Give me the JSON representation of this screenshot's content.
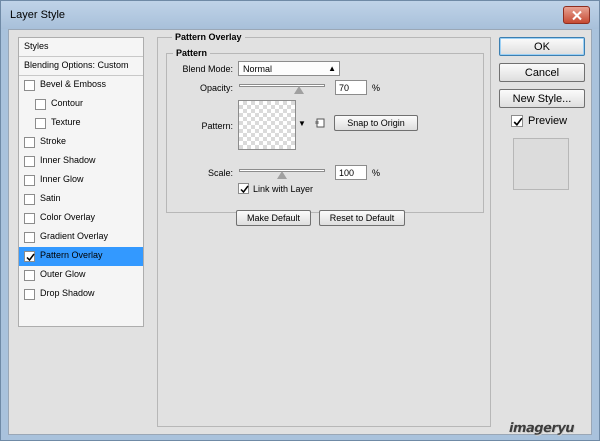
{
  "window": {
    "title": "Layer Style",
    "close_icon": "close-icon"
  },
  "styles": {
    "header": "Styles",
    "blending_options": "Blending Options: Custom",
    "items": [
      {
        "label": "Bevel & Emboss",
        "checked": false,
        "indent": false,
        "selected": false
      },
      {
        "label": "Contour",
        "checked": false,
        "indent": true,
        "selected": false
      },
      {
        "label": "Texture",
        "checked": false,
        "indent": true,
        "selected": false
      },
      {
        "label": "Stroke",
        "checked": false,
        "indent": false,
        "selected": false
      },
      {
        "label": "Inner Shadow",
        "checked": false,
        "indent": false,
        "selected": false
      },
      {
        "label": "Inner Glow",
        "checked": false,
        "indent": false,
        "selected": false
      },
      {
        "label": "Satin",
        "checked": false,
        "indent": false,
        "selected": false
      },
      {
        "label": "Color Overlay",
        "checked": false,
        "indent": false,
        "selected": false
      },
      {
        "label": "Gradient Overlay",
        "checked": false,
        "indent": false,
        "selected": false
      },
      {
        "label": "Pattern Overlay",
        "checked": true,
        "indent": false,
        "selected": true
      },
      {
        "label": "Outer Glow",
        "checked": false,
        "indent": false,
        "selected": false
      },
      {
        "label": "Drop Shadow",
        "checked": false,
        "indent": false,
        "selected": false
      }
    ]
  },
  "pattern_overlay": {
    "section_title": "Pattern Overlay",
    "group_title": "Pattern",
    "blend_mode_label": "Blend Mode:",
    "blend_mode_value": "Normal",
    "opacity_label": "Opacity:",
    "opacity_value": "70",
    "opacity_unit": "%",
    "pattern_label": "Pattern:",
    "snap_to_origin": "Snap to Origin",
    "scale_label": "Scale:",
    "scale_value": "100",
    "scale_unit": "%",
    "link_with_layer": "Link with Layer",
    "link_checked": true,
    "make_default": "Make Default",
    "reset_to_default": "Reset to Default"
  },
  "buttons": {
    "ok": "OK",
    "cancel": "Cancel",
    "new_style": "New Style...",
    "preview": "Preview",
    "preview_checked": true
  },
  "watermark": "imageryu",
  "colors": {
    "selected_row": "#3399ff",
    "dialog_bg": "#e1e1e1",
    "title_bar": "#a9c2dc",
    "close_button": "#c64a32"
  }
}
